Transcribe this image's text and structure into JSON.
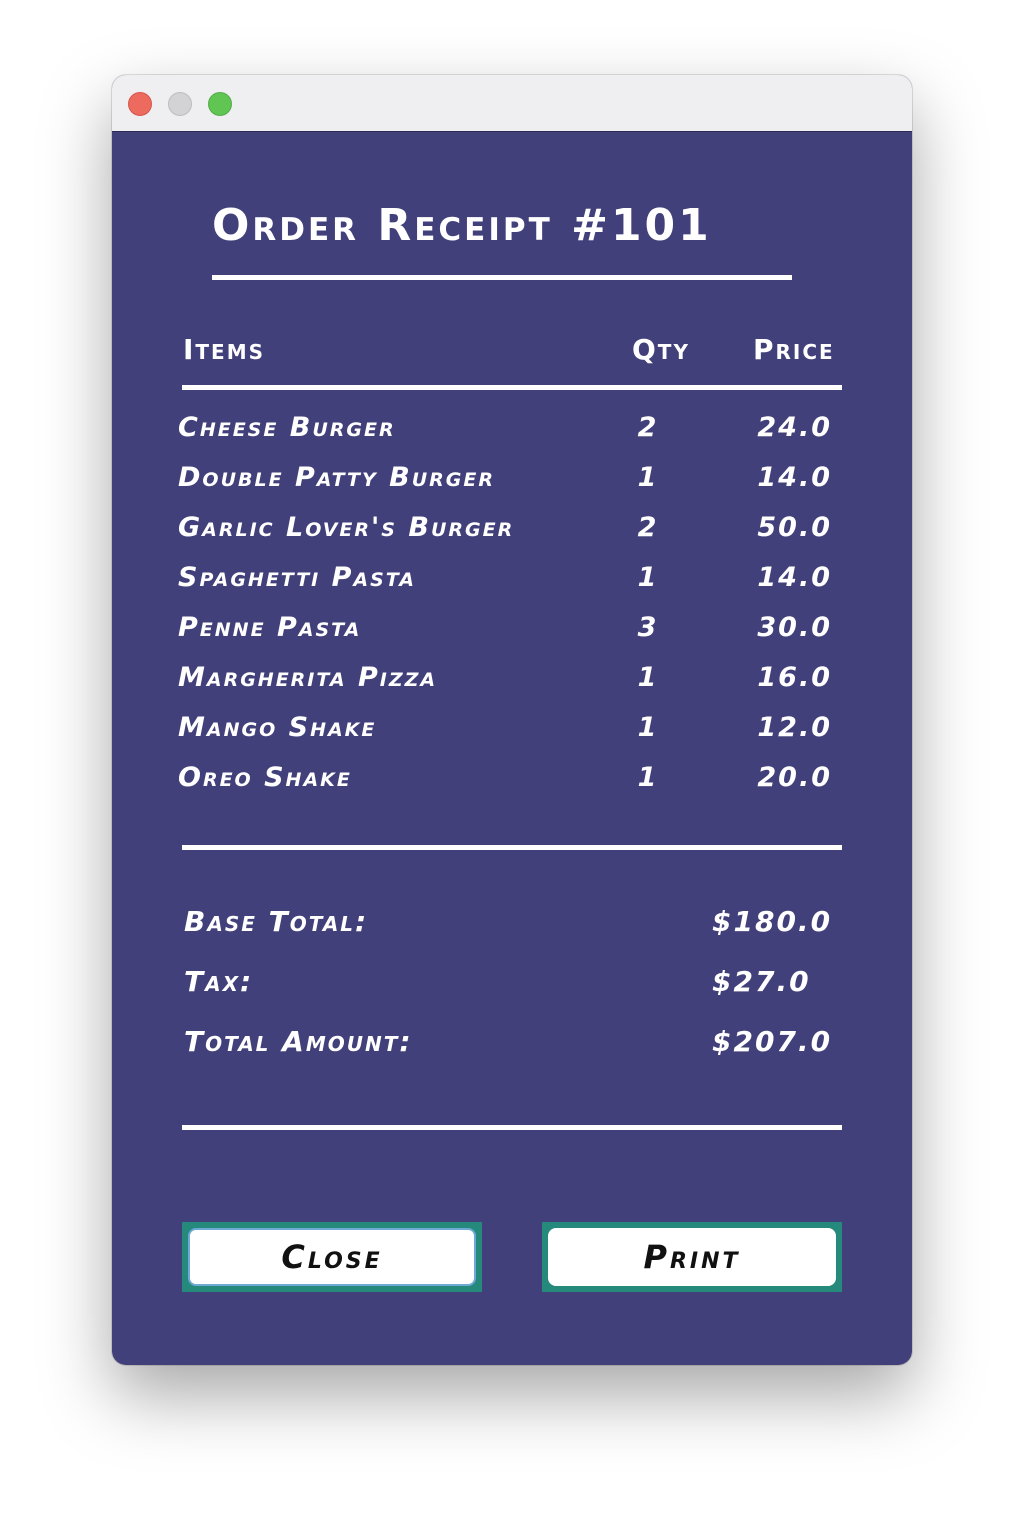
{
  "receipt": {
    "title": "Order Receipt #101",
    "headers": {
      "items": "Items",
      "qty": "Qty",
      "price": "Price"
    },
    "items": [
      {
        "name": "Cheese Burger",
        "qty": "2",
        "price": "24.0"
      },
      {
        "name": "Double Patty Burger",
        "qty": "1",
        "price": "14.0"
      },
      {
        "name": "Garlic Lover's Burger",
        "qty": "2",
        "price": "50.0"
      },
      {
        "name": "Spaghetti Pasta",
        "qty": "1",
        "price": "14.0"
      },
      {
        "name": "Penne Pasta",
        "qty": "3",
        "price": "30.0"
      },
      {
        "name": "Margherita Pizza",
        "qty": "1",
        "price": "16.0"
      },
      {
        "name": "Mango Shake",
        "qty": "1",
        "price": "12.0"
      },
      {
        "name": "Oreo Shake",
        "qty": "1",
        "price": "20.0"
      }
    ],
    "summary": {
      "base_total_label": "Base Total:",
      "base_total_value": "$180.0",
      "tax_label": "Tax:",
      "tax_value": "$27.0",
      "total_label": "Total Amount:",
      "total_value": "$207.0"
    }
  },
  "buttons": {
    "close_label": "Close",
    "print_label": "Print"
  },
  "colors": {
    "background": "#42407a",
    "button_border": "#258a7b",
    "text": "#ffffff"
  }
}
